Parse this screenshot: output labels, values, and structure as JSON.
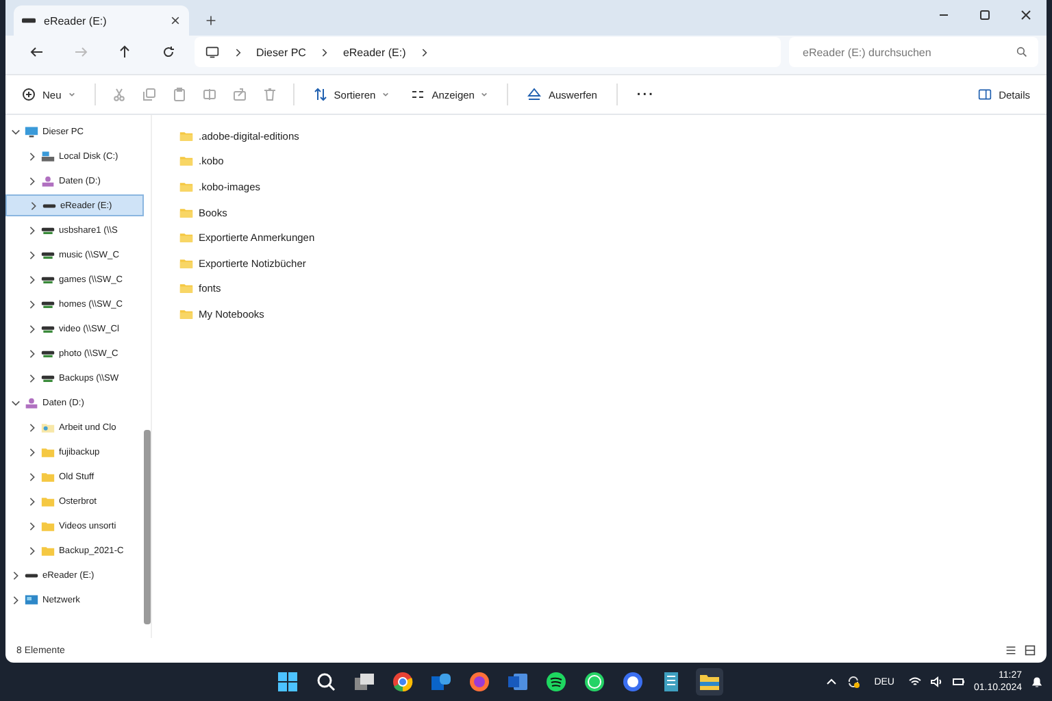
{
  "window": {
    "tab_title": "eReader (E:)"
  },
  "address": {
    "crumbs": [
      "Dieser PC",
      "eReader (E:)"
    ],
    "search_placeholder": "eReader (E:) durchsuchen"
  },
  "toolbar": {
    "new_label": "Neu",
    "sort_label": "Sortieren",
    "view_label": "Anzeigen",
    "eject_label": "Auswerfen",
    "more_label": "···",
    "details_label": "Details"
  },
  "sidebar": {
    "items": [
      {
        "label": "Dieser PC",
        "kind": "pc",
        "expanded": true,
        "selected": false,
        "children": [
          {
            "label": "Local Disk (C:)",
            "kind": "system-disk",
            "expanded": false,
            "selected": false
          },
          {
            "label": "Daten (D:)",
            "kind": "data-disk",
            "expanded": false,
            "selected": false
          },
          {
            "label": "eReader (E:)",
            "kind": "drive",
            "expanded": false,
            "selected": true
          },
          {
            "label": "usbshare1 (\\\\S",
            "kind": "net-drive",
            "expanded": false,
            "selected": false
          },
          {
            "label": "music (\\\\SW_C",
            "kind": "net-drive",
            "expanded": false,
            "selected": false
          },
          {
            "label": "games (\\\\SW_C",
            "kind": "net-drive",
            "expanded": false,
            "selected": false
          },
          {
            "label": "homes (\\\\SW_C",
            "kind": "net-drive",
            "expanded": false,
            "selected": false
          },
          {
            "label": "video (\\\\SW_Cl",
            "kind": "net-drive",
            "expanded": false,
            "selected": false
          },
          {
            "label": "photo (\\\\SW_C",
            "kind": "net-drive",
            "expanded": false,
            "selected": false
          },
          {
            "label": "Backups (\\\\SW",
            "kind": "net-drive",
            "expanded": false,
            "selected": false
          }
        ]
      },
      {
        "label": "Daten (D:)",
        "kind": "data-disk",
        "expanded": true,
        "selected": false,
        "children": [
          {
            "label": "Arbeit und Clo",
            "kind": "sync-folder",
            "expanded": false,
            "selected": false
          },
          {
            "label": "fujibackup",
            "kind": "folder",
            "expanded": false,
            "selected": false
          },
          {
            "label": "Old Stuff",
            "kind": "folder",
            "expanded": false,
            "selected": false
          },
          {
            "label": "Osterbrot",
            "kind": "folder",
            "expanded": false,
            "selected": false
          },
          {
            "label": "Videos unsorti",
            "kind": "folder",
            "expanded": false,
            "selected": false
          },
          {
            "label": "Backup_2021-C",
            "kind": "folder",
            "expanded": false,
            "selected": false
          }
        ]
      },
      {
        "label": "eReader (E:)",
        "kind": "drive",
        "expanded": false,
        "selected": false
      },
      {
        "label": "Netzwerk",
        "kind": "network",
        "expanded": false,
        "selected": false
      }
    ]
  },
  "files": [
    ".adobe-digital-editions",
    ".kobo",
    ".kobo-images",
    "Books",
    "Exportierte Anmerkungen",
    "Exportierte Notizbücher",
    "fonts",
    "My Notebooks"
  ],
  "status_bar": {
    "count": "8 Elemente"
  },
  "taskbar": {
    "language": "DEU",
    "time": "11:27",
    "date": "01.10.2024"
  }
}
